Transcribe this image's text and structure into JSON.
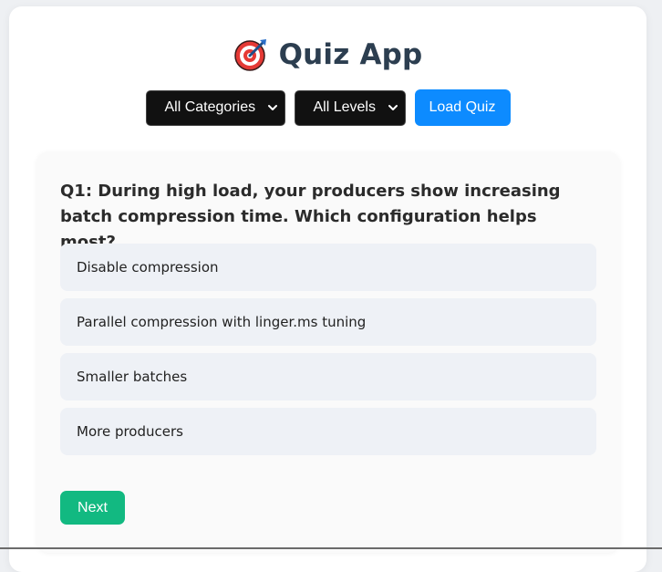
{
  "app": {
    "title": "Quiz App",
    "logo_icon": "target-dart-icon"
  },
  "controls": {
    "category": {
      "selected": "All Categories"
    },
    "level": {
      "selected": "All Levels"
    },
    "load_button": "Load Quiz"
  },
  "quiz": {
    "question": "Q1: During high load, your producers show increasing batch compression time. Which configuration helps most?",
    "options": [
      "Disable compression",
      "Parallel compression with linger.ms tuning",
      "Smaller batches",
      "More producers"
    ],
    "next_button": "Next"
  },
  "colors": {
    "title": "#2c3e50",
    "select_bg": "#111111",
    "load_button": "#0d8bff",
    "next_button": "#12b981",
    "option_bg": "#eef1f6"
  }
}
